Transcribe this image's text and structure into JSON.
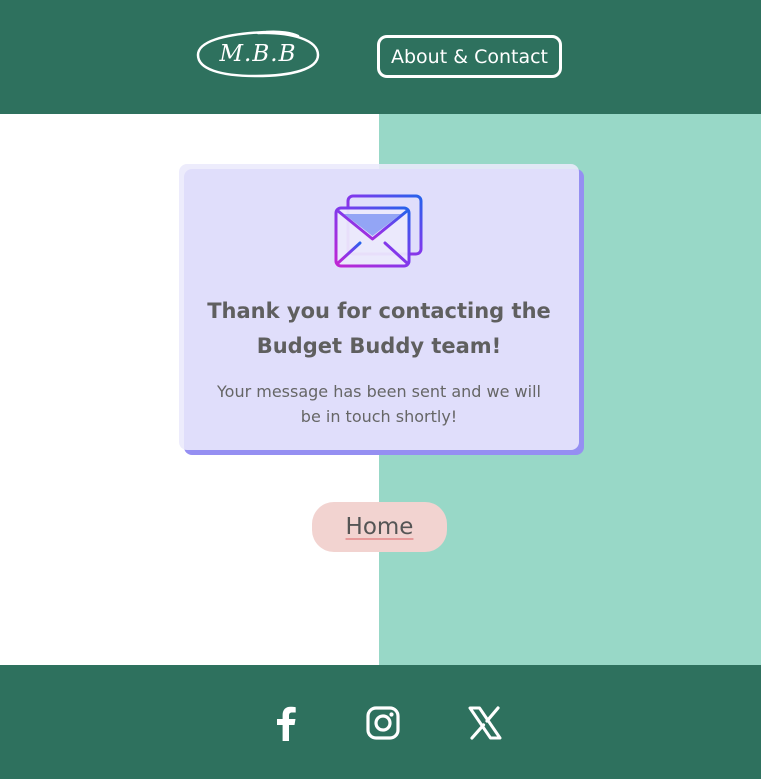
{
  "header": {
    "logo_text": "M.B.B",
    "nav": {
      "about_contact": "About & Contact"
    }
  },
  "card": {
    "icon": "envelope-icon",
    "title_line1": "Thank you for contacting the",
    "title_line2": "Budget Buddy team!",
    "message_line1": "Your message has been sent and we will",
    "message_line2": "be in touch shortly!"
  },
  "home_button": {
    "label": "Home"
  },
  "footer": {
    "social": [
      {
        "name": "facebook-icon"
      },
      {
        "name": "instagram-icon"
      },
      {
        "name": "x-twitter-icon"
      }
    ]
  },
  "colors": {
    "header_footer_bg": "#2e715e",
    "teal_panel": "#98d8c7",
    "card_bg": "#ebe9fc",
    "card_shadow": "#958ff2",
    "home_button_bg": "#f2d3d0"
  }
}
